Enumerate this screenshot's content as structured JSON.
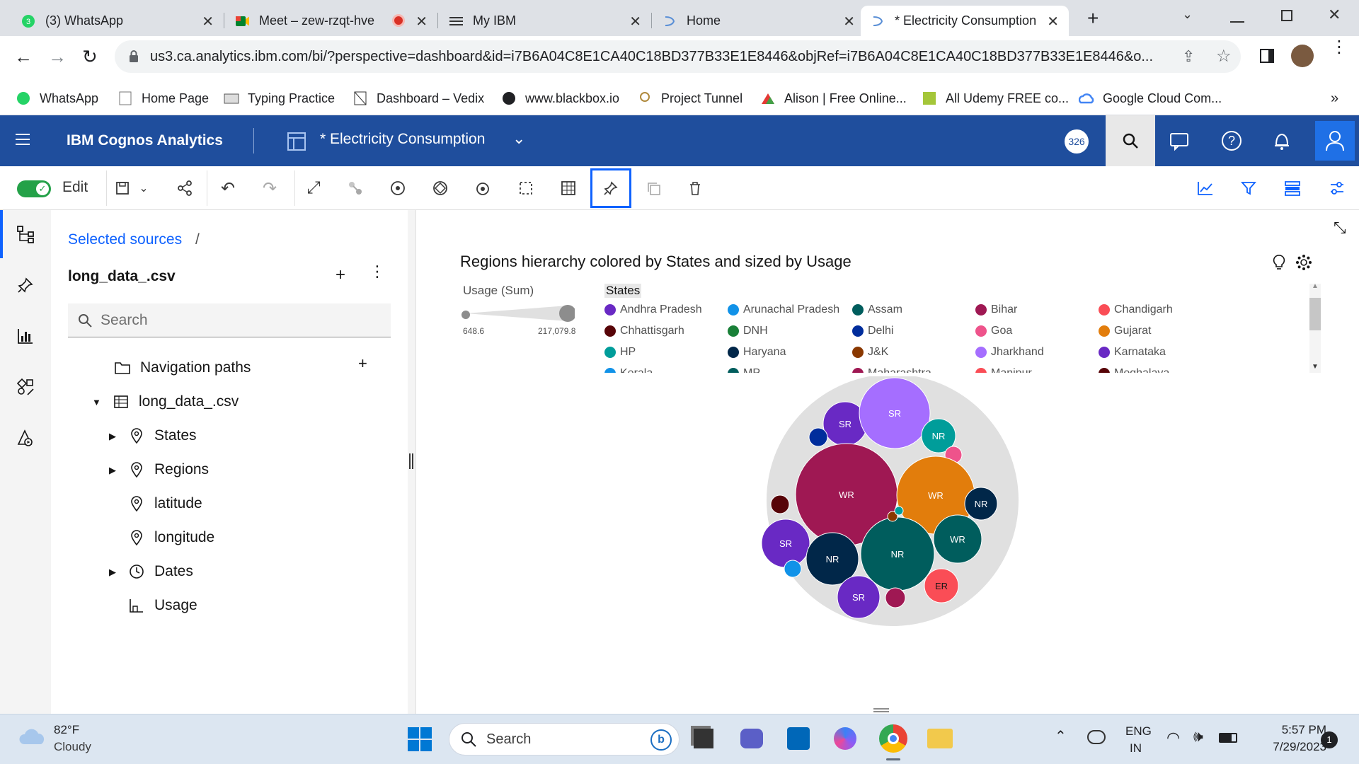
{
  "browser": {
    "tabs": [
      {
        "label": "(3) WhatsApp",
        "icon": "whatsapp-icon"
      },
      {
        "label": "Meet – zew-rzqt-hve",
        "icon": "meet-icon"
      },
      {
        "label": "My IBM",
        "icon": "ibm-icon"
      },
      {
        "label": "Home",
        "icon": "cognos-icon"
      },
      {
        "label": "* Electricity Consumption",
        "icon": "cognos-icon",
        "active": true
      }
    ],
    "url": "us3.ca.analytics.ibm.com/bi/?perspective=dashboard&id=i7B6A04C8E1CA40C18BD377B33E1E8446&objRef=i7B6A04C8E1CA40C18BD377B33E1E8446&o...",
    "bookmarks": [
      "WhatsApp",
      "Home Page",
      "Typing Practice",
      "Dashboard – Vedix",
      "www.blackbox.io",
      "Project Tunnel",
      "Alison | Free Online...",
      "All Udemy FREE co...",
      "Google Cloud Com..."
    ],
    "bookmarks_more": "»"
  },
  "app": {
    "product": "IBM Cognos Analytics",
    "dashboard_title": "* Electricity Consumption",
    "notification_count": "326"
  },
  "toolbar": {
    "edit_label": "Edit"
  },
  "sources": {
    "breadcrumb": "Selected sources",
    "breadcrumb_sep": "/",
    "file": "long_data_.csv",
    "search_placeholder": "Search",
    "nav_paths": "Navigation paths",
    "table": "long_data_.csv",
    "fields": [
      "States",
      "Regions",
      "latitude",
      "longitude",
      "Dates",
      "Usage"
    ]
  },
  "chart": {
    "title": "Regions hierarchy colored by States and sized by Usage",
    "size_legend_title": "Usage (Sum)",
    "size_min": "648.6",
    "size_max": "217,079.8",
    "color_legend_title": "States",
    "states": [
      {
        "name": "Andhra Pradesh",
        "color": "#6929c4"
      },
      {
        "name": "Arunachal Pradesh",
        "color": "#1192e8"
      },
      {
        "name": "Assam",
        "color": "#005d5d"
      },
      {
        "name": "Bihar",
        "color": "#9f1853"
      },
      {
        "name": "Chandigarh",
        "color": "#fa4d56"
      },
      {
        "name": "Chhattisgarh",
        "color": "#570408"
      },
      {
        "name": "DNH",
        "color": "#198038"
      },
      {
        "name": "Delhi",
        "color": "#002d9c"
      },
      {
        "name": "Goa",
        "color": "#ee538b"
      },
      {
        "name": "Gujarat",
        "color": "#e27d0c"
      },
      {
        "name": "HP",
        "color": "#009d9a"
      },
      {
        "name": "Haryana",
        "color": "#012749"
      },
      {
        "name": "J&K",
        "color": "#8a3800"
      },
      {
        "name": "Jharkhand",
        "color": "#a56eff"
      },
      {
        "name": "Karnataka",
        "color": "#6929c4"
      },
      {
        "name": "Kerala",
        "color": "#1192e8"
      },
      {
        "name": "MP",
        "color": "#005d5d"
      },
      {
        "name": "Maharashtra",
        "color": "#9f1853"
      },
      {
        "name": "Manipur",
        "color": "#fa4d56"
      },
      {
        "name": "Meghalaya",
        "color": "#570408"
      }
    ]
  },
  "chart_data": {
    "type": "bubble-pack",
    "title": "Regions hierarchy colored by States and sized by Usage",
    "size_range": [
      648.6,
      217079.8
    ],
    "bubbles": [
      {
        "label": "SR",
        "color": "#6929c4"
      },
      {
        "label": "SR",
        "color": "#a56eff"
      },
      {
        "label": "NR",
        "color": "#009d9a"
      },
      {
        "label": "",
        "color": "#002d9c"
      },
      {
        "label": "",
        "color": "#ee538b"
      },
      {
        "label": "WR",
        "color": "#9f1853"
      },
      {
        "label": "WR",
        "color": "#e27d0c"
      },
      {
        "label": "NR",
        "color": "#012749"
      },
      {
        "label": "",
        "color": "#570408"
      },
      {
        "label": "SR",
        "color": "#6929c4"
      },
      {
        "label": "NR",
        "color": "#012749"
      },
      {
        "label": "NR",
        "color": "#005d5d"
      },
      {
        "label": "WR",
        "color": "#005d5d"
      },
      {
        "label": "ER",
        "color": "#fa4d56"
      },
      {
        "label": "",
        "color": "#1192e8"
      },
      {
        "label": "SR",
        "color": "#6929c4"
      },
      {
        "label": "",
        "color": "#9f1853"
      },
      {
        "label": "",
        "color": "#8a3800"
      },
      {
        "label": "",
        "color": "#009d9a"
      }
    ]
  },
  "taskbar": {
    "weather_temp": "82°F",
    "weather_desc": "Cloudy",
    "search": "Search",
    "lang1": "ENG",
    "lang2": "IN",
    "time": "5:57 PM",
    "date": "7/29/2023",
    "notif": "1"
  }
}
